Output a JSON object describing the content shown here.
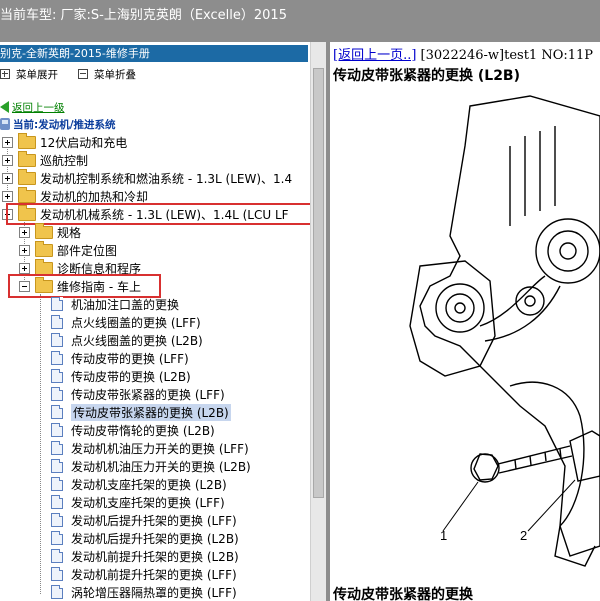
{
  "window": {
    "car_label": "当前车型:  厂家:S-上海别克英朗（Excelle）2015"
  },
  "left_panel": {
    "manual_title": "别克-全新英朗-2015-维修手册",
    "toolbar": {
      "expand_all": "菜单展开",
      "collapse_all": "菜单折叠"
    },
    "back_link": "返回上一级",
    "current_location": "当前:发动机/推进系统",
    "tree": {
      "top_items": [
        "12伏启动和充电",
        "巡航控制",
        "发动机控制系统和燃油系统 - 1.3L (LEW)、1.4",
        "发动机的加热和冷却",
        "发动机机械系统 - 1.3L (LEW)、1.4L (LCU LF"
      ],
      "sub_items": [
        "规格",
        "部件定位图",
        "诊断信息和程序",
        "维修指南 - 车上"
      ],
      "documents": [
        "机油加注口盖的更换",
        "点火线圈盖的更换 (LFF)",
        "点火线圈盖的更换 (L2B)",
        "传动皮带的更换 (LFF)",
        "传动皮带的更换 (L2B)",
        "传动皮带张紧器的更换 (LFF)",
        "传动皮带张紧器的更换 (L2B)",
        "传动皮带惰轮的更换 (L2B)",
        "发动机机油压力开关的更换 (LFF)",
        "发动机机油压力开关的更换 (L2B)",
        "发动机支座托架的更换 (L2B)",
        "发动机支座托架的更换 (LFF)",
        "发动机后提升托架的更换 (LFF)",
        "发动机后提升托架的更换 (L2B)",
        "发动机前提升托架的更换 (L2B)",
        "发动机前提升托架的更换 (LFF)",
        "涡轮增压器隔热罩的更换 (LFF)"
      ]
    }
  },
  "doc_panel": {
    "back_page_link": "[返回上一页..]",
    "doc_id_text": " [3022246-w]test1 NO:11P",
    "title": "传动皮带张紧器的更换 (L2B)",
    "figure_callouts": [
      "1",
      "2"
    ],
    "bottom_heading": "传动皮带张紧器的更换"
  },
  "colors": {
    "title_bar": "#8d8d8d",
    "manual_title_bg": "#1c6aa5",
    "highlight_box": "#d83030",
    "selection_bg": "#c7d6ee",
    "back_link_green": "#008000",
    "current_blue": "#0a3c9c"
  },
  "icons": {
    "folder": "folder-icon",
    "document": "document-icon",
    "expander": "tree-expander-icon",
    "back": "green-back-arrow-icon",
    "current": "current-location-icon"
  }
}
